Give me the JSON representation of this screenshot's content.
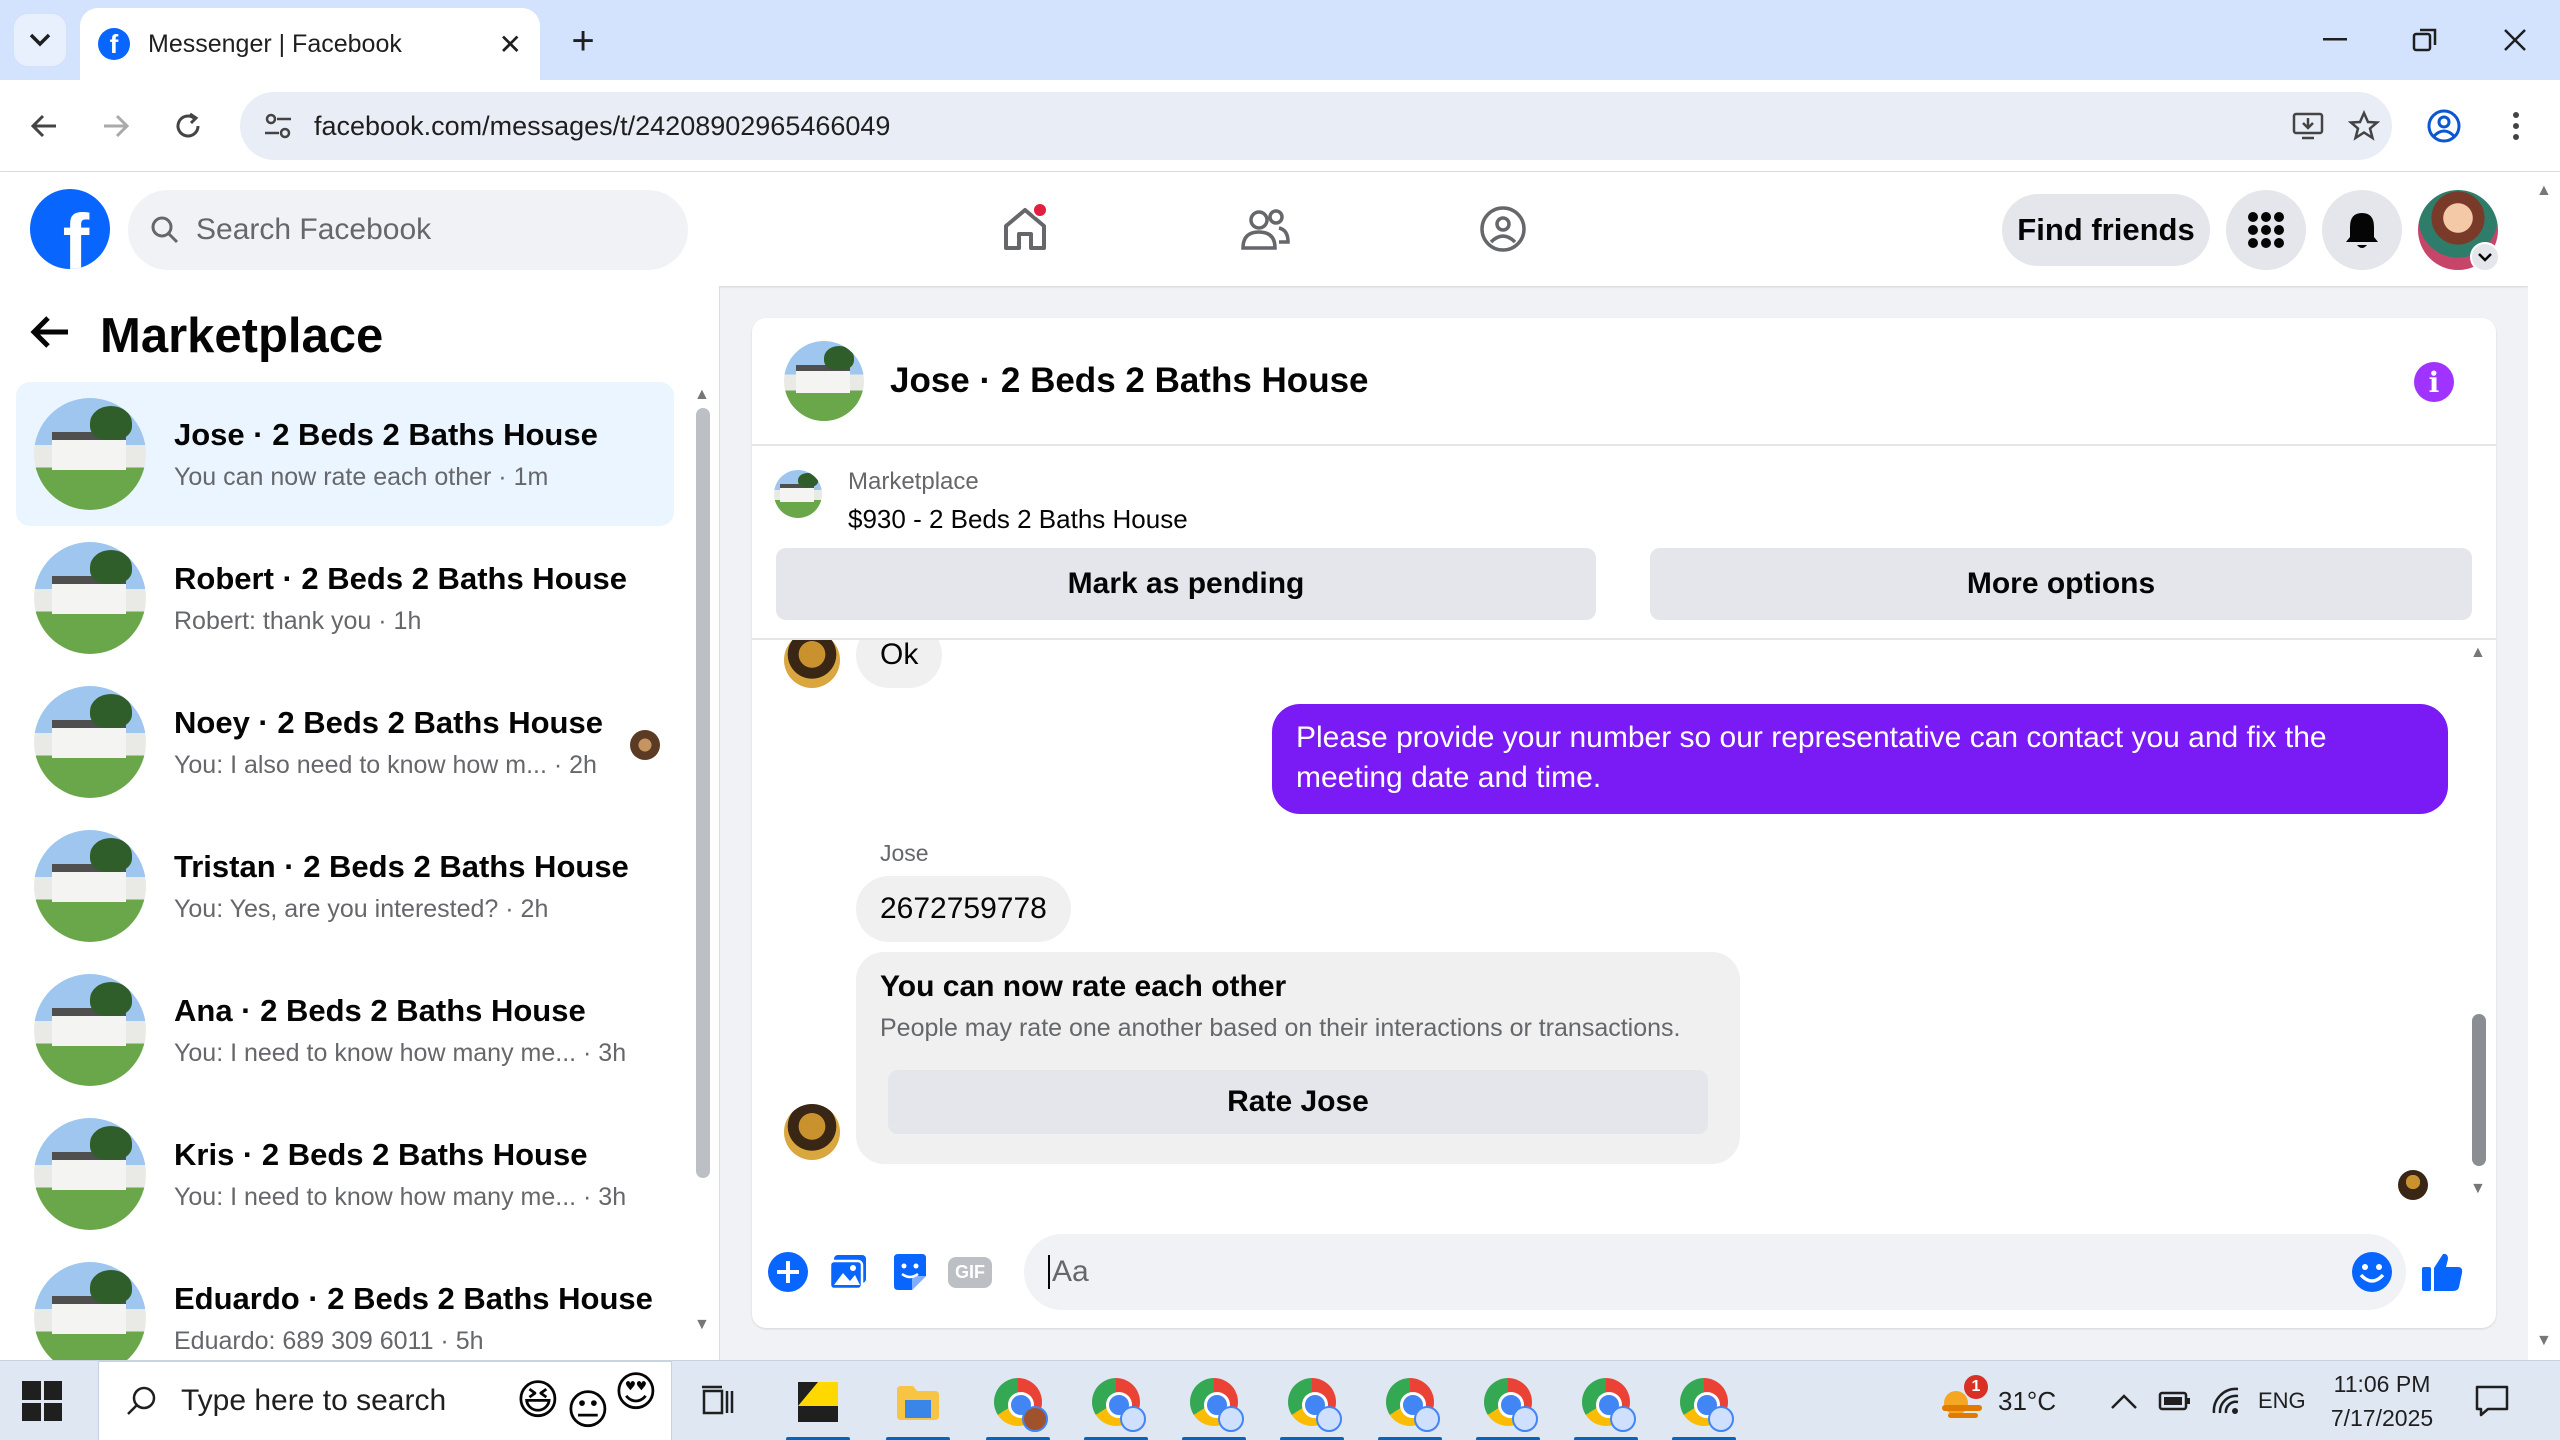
{
  "browser": {
    "tab_title": "Messenger | Facebook",
    "url": "facebook.com/messages/t/24208902965466049",
    "new_tab_glyph": "+",
    "close_glyph": "✕"
  },
  "fb_header": {
    "search_placeholder": "Search Facebook",
    "find_friends_label": "Find friends",
    "logo_letter": "f"
  },
  "sidebar": {
    "title": "Marketplace",
    "conversations": [
      {
        "name": "Jose · 2 Beds 2 Baths House",
        "snippet": "You can now rate each other · 1m",
        "active": true
      },
      {
        "name": "Robert · 2 Beds 2 Baths House",
        "snippet": "Robert: thank you · 1h",
        "active": false
      },
      {
        "name": "Noey · 2 Beds 2 Baths House",
        "snippet": "You: I also need to know how m...  · 2h",
        "active": false
      },
      {
        "name": "Tristan · 2 Beds 2 Baths House",
        "snippet": "You: Yes, are you interested? · 2h",
        "active": false
      },
      {
        "name": "Ana · 2 Beds 2 Baths House",
        "snippet": "You: I need to know how many me...  · 3h",
        "active": false
      },
      {
        "name": "Kris · 2 Beds 2 Baths House",
        "snippet": "You: I need to know how many me...  · 3h",
        "active": false
      },
      {
        "name": "Eduardo · 2 Beds 2 Baths House",
        "snippet": "Eduardo: 689 309 6011 · 5h",
        "active": false
      }
    ]
  },
  "chat": {
    "title": "Jose · 2 Beds 2 Baths House",
    "info_glyph": "i",
    "listing_label": "Marketplace",
    "listing_price_title": "$930 - 2 Beds 2 Baths House",
    "mark_pending_label": "Mark as pending",
    "more_options_label": "More options",
    "messages": {
      "incoming_ok": "Ok",
      "outgoing_request": "Please provide your number so our representative can contact you and fix the meeting date and time.",
      "sender_name": "Jose",
      "incoming_number": "2672759778"
    },
    "rating_card": {
      "title": "You can now rate each other",
      "description": "People may rate one another based on their interactions or transactions.",
      "button_label": "Rate Jose"
    },
    "composer_placeholder": "Aa",
    "gif_label": "GIF"
  },
  "taskbar": {
    "search_placeholder": "Type here to search",
    "weather": "31°C",
    "weather_badge": "1",
    "language": "ENG",
    "time": "11:06 PM",
    "date": "7/17/2025"
  },
  "colors": {
    "fb_blue": "#0866ff",
    "messenger_purple": "#7a1bf5",
    "active_row": "#ebf5ff",
    "notification_red": "#e41e3f"
  }
}
